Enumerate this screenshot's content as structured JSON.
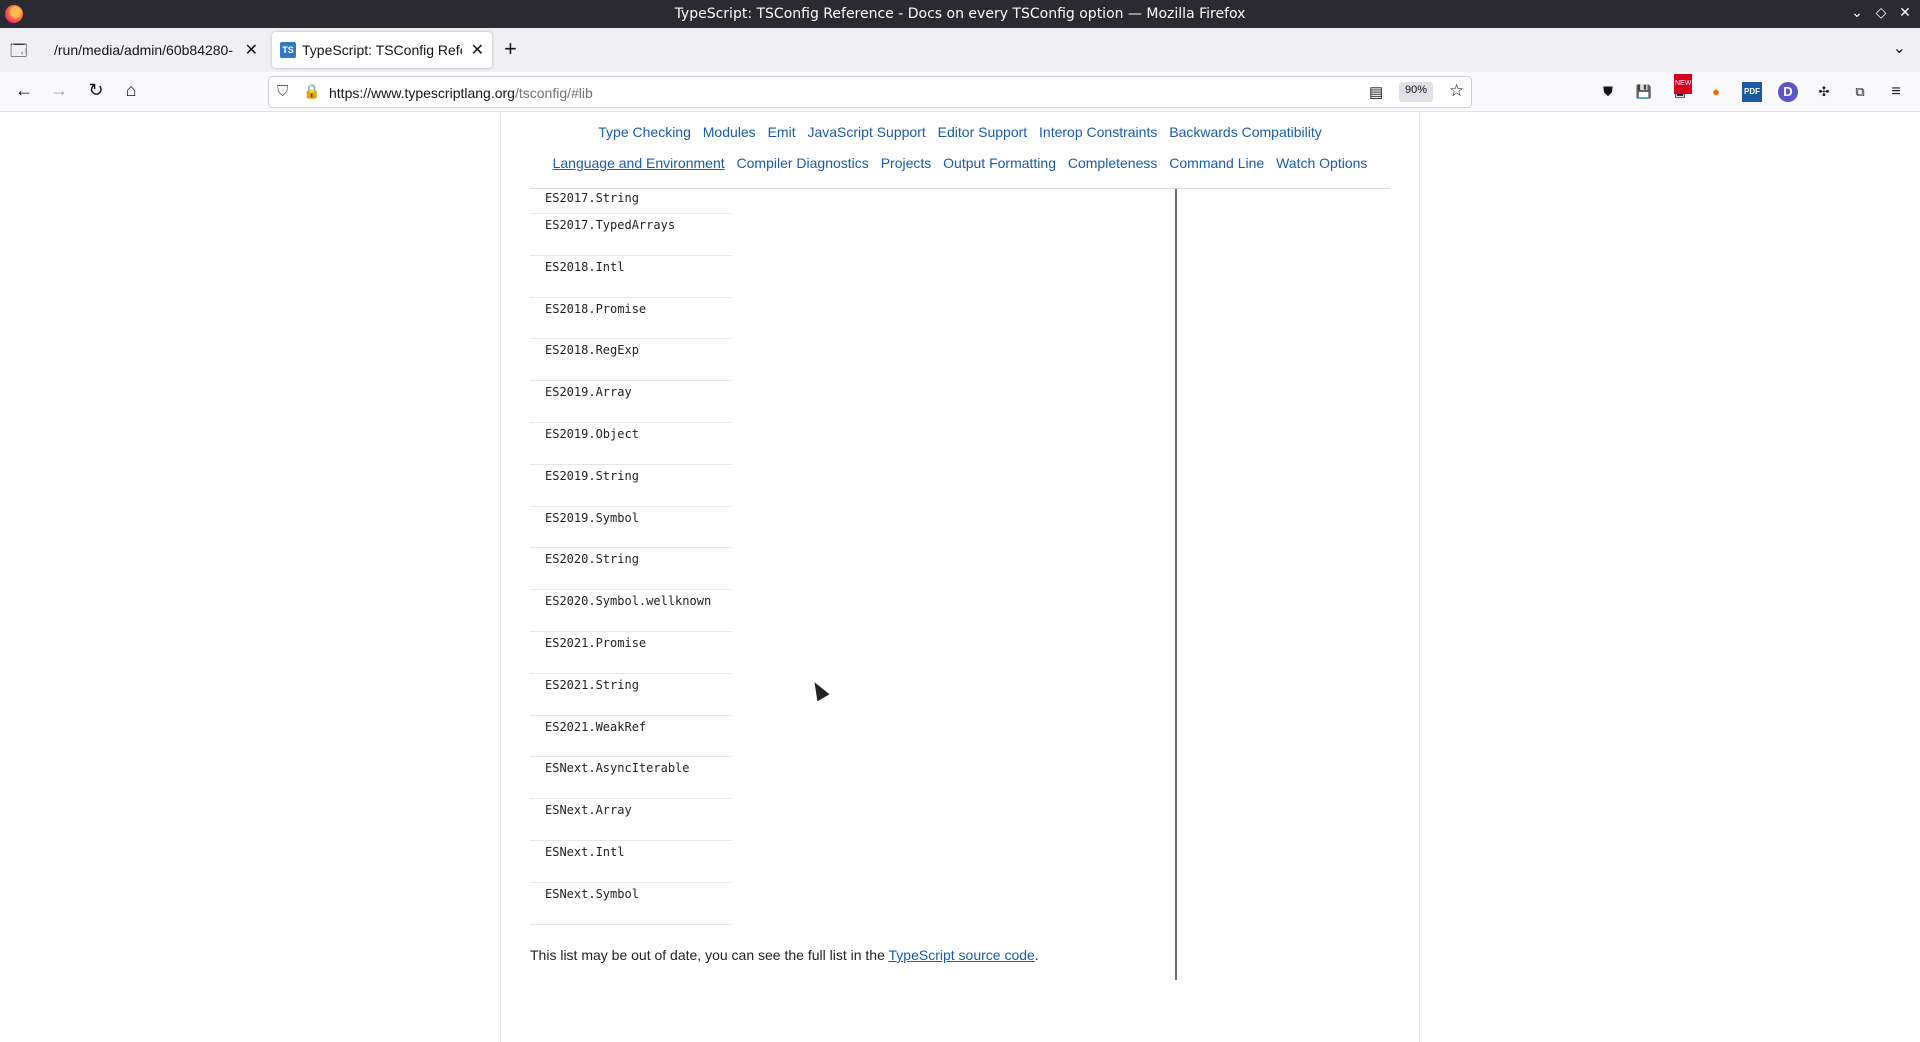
{
  "window": {
    "title": "TypeScript: TSConfig Reference - Docs on every TSConfig option — Mozilla Firefox"
  },
  "tabs": [
    {
      "label": "/run/media/admin/60b84280-",
      "active": false
    },
    {
      "label": "TypeScript: TSConfig Refer",
      "active": true,
      "favicon": "TS"
    }
  ],
  "navbar": {
    "url_host": "https://www.typescriptlang.org",
    "url_path": "/tsconfig/#lib",
    "zoom": "90%"
  },
  "extensions": {
    "new_badge": "NEW",
    "pdf_label": "PDF",
    "d_label": "D"
  },
  "category_nav": {
    "row1": [
      "Type Checking",
      "Modules",
      "Emit",
      "JavaScript Support",
      "Editor Support",
      "Interop Constraints",
      "Backwards Compatibility"
    ],
    "row2": [
      "Language and Environment",
      "Compiler Diagnostics",
      "Projects",
      "Output Formatting",
      "Completeness",
      "Command Line",
      "Watch Options"
    ],
    "current": "Language and Environment"
  },
  "lib_items": [
    "ES2017.String",
    "ES2017.TypedArrays",
    "ES2018.Intl",
    "ES2018.Promise",
    "ES2018.RegExp",
    "ES2019.Array",
    "ES2019.Object",
    "ES2019.String",
    "ES2019.Symbol",
    "ES2020.String",
    "ES2020.Symbol.wellknown",
    "ES2021.Promise",
    "ES2021.String",
    "ES2021.WeakRef",
    "ESNext.AsyncIterable",
    "ESNext.Array",
    "ESNext.Intl",
    "ESNext.Symbol"
  ],
  "footnote": {
    "text_before": "This list may be out of date, you can see the full list in the ",
    "link": "TypeScript source code",
    "text_after": "."
  }
}
